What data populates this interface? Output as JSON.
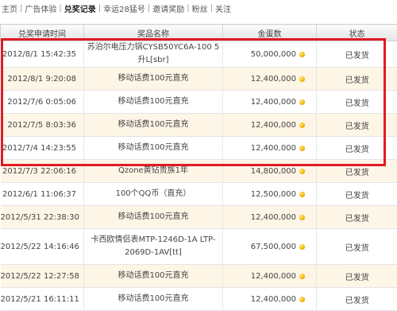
{
  "nav": {
    "items": [
      {
        "label": "主页",
        "active": false
      },
      {
        "label": "广告体验",
        "active": false
      },
      {
        "label": "兑奖记录",
        "active": true
      },
      {
        "label": "幸运28猛号",
        "active": false
      },
      {
        "label": "邀请奖励",
        "active": false
      },
      {
        "label": "粉丝",
        "active": false
      },
      {
        "label": "关注",
        "active": false
      }
    ],
    "separator": "|"
  },
  "table": {
    "headers": {
      "time": "兑奖申请时间",
      "prize": "奖品名称",
      "amount": "金蛋数",
      "status": "状态"
    },
    "rows": [
      {
        "time": "2012/8/1 15:42:35",
        "prize": "苏泊尔电压力锅CYSB50YC6A-100 5升L[sbr]",
        "amount": "50,000,000",
        "status": "已发货"
      },
      {
        "time": "2012/8/1 9:20:08",
        "prize": "移动话费100元直充",
        "amount": "12,400,000",
        "status": "已发货"
      },
      {
        "time": "2012/7/6 0:05:06",
        "prize": "移动话费100元直充",
        "amount": "12,400,000",
        "status": "已发货"
      },
      {
        "time": "2012/7/5 8:03:36",
        "prize": "移动话费100元直充",
        "amount": "12,400,000",
        "status": "已发货"
      },
      {
        "time": "2012/7/4 14:23:55",
        "prize": "移动话费100元直充",
        "amount": "12,400,000",
        "status": "已发货"
      },
      {
        "time": "2012/7/3 22:06:16",
        "prize": "Qzone黄钻贵族1年",
        "amount": "14,800,000",
        "status": "已发货"
      },
      {
        "time": "2012/6/1 11:06:37",
        "prize": "100个QQ币（直充）",
        "amount": "12,500,000",
        "status": "已发货"
      },
      {
        "time": "2012/5/31 22:38:30",
        "prize": "移动话费100元直充",
        "amount": "12,400,000",
        "status": "已发货"
      },
      {
        "time": "2012/5/22 14:16:46",
        "prize": "卡西欧情侣表MTP-1246D-1A LTP-2069D-1AV[tt]",
        "amount": "67,500,000",
        "status": "已发货"
      },
      {
        "time": "2012/5/22 12:27:58",
        "prize": "移动话费100元直充",
        "amount": "12,400,000",
        "status": "已发货"
      },
      {
        "time": "2012/5/21 16:11:11",
        "prize": "移动话费100元直充",
        "amount": "12,400,000",
        "status": "已发货"
      }
    ]
  },
  "icons": {
    "currency": "gold-egg-coin-icon"
  },
  "colors": {
    "highlight": "#e01b24",
    "amount": "#cc0000",
    "row_alt": "#fdf5e6"
  }
}
